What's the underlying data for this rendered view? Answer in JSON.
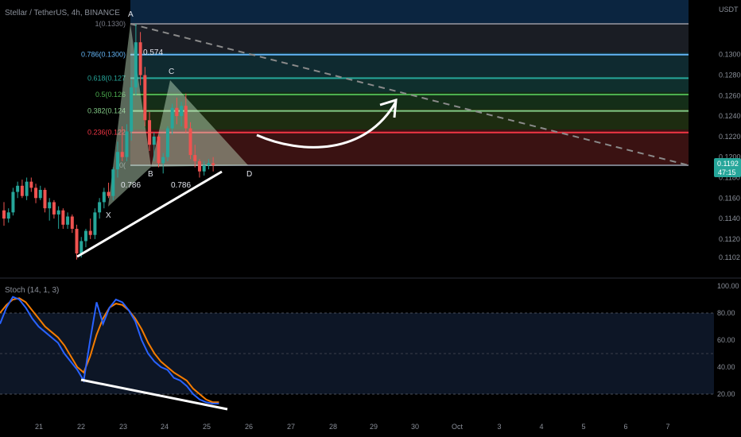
{
  "header": {
    "title": "Stellar / TetherUS, 4h, BINANCE",
    "currency": "USDT"
  },
  "indicator": {
    "label": "Stoch (14, 1, 3)"
  },
  "last_price": {
    "value": "0.1192",
    "countdown": "47:15",
    "color": "#26a69a"
  },
  "chart_data": [
    {
      "type": "candlestick",
      "x_dates": [
        "21",
        "22",
        "23",
        "24",
        "25",
        "26",
        "27",
        "28",
        "29",
        "30",
        "Oct",
        "3",
        "4",
        "5",
        "6",
        "7"
      ],
      "y_ticks": [
        "0.1300",
        "0.1280",
        "0.1260",
        "0.1240",
        "0.1220",
        "0.1200",
        "0.1180",
        "0.1160",
        "0.1140",
        "0.1120",
        "0.1102"
      ],
      "ylim": [
        0.1095,
        0.134
      ],
      "candles": [
        [
          0.1148,
          0.1156,
          0.1133,
          0.114
        ],
        [
          0.114,
          0.115,
          0.1136,
          0.1146
        ],
        [
          0.1146,
          0.117,
          0.1143,
          0.1166
        ],
        [
          0.1166,
          0.1176,
          0.116,
          0.1172
        ],
        [
          0.1172,
          0.1178,
          0.116,
          0.1162
        ],
        [
          0.1162,
          0.118,
          0.1158,
          0.1176
        ],
        [
          0.1176,
          0.118,
          0.1166,
          0.117
        ],
        [
          0.117,
          0.1174,
          0.1155,
          0.116
        ],
        [
          0.116,
          0.1172,
          0.1158,
          0.1168
        ],
        [
          0.1168,
          0.117,
          0.1146,
          0.115
        ],
        [
          0.115,
          0.116,
          0.1138,
          0.1156
        ],
        [
          0.1156,
          0.1158,
          0.114,
          0.1144
        ],
        [
          0.1144,
          0.1152,
          0.113,
          0.1148
        ],
        [
          0.1148,
          0.115,
          0.113,
          0.1134
        ],
        [
          0.1134,
          0.1146,
          0.113,
          0.1142
        ],
        [
          0.1142,
          0.1144,
          0.1126,
          0.113
        ],
        [
          0.113,
          0.1134,
          0.11,
          0.1106
        ],
        [
          0.1106,
          0.1122,
          0.1102,
          0.1118
        ],
        [
          0.1118,
          0.113,
          0.1112,
          0.1128
        ],
        [
          0.1128,
          0.114,
          0.112,
          0.1124
        ],
        [
          0.1124,
          0.115,
          0.112,
          0.1146
        ],
        [
          0.1146,
          0.116,
          0.114,
          0.1156
        ],
        [
          0.1156,
          0.117,
          0.115,
          0.1166
        ],
        [
          0.1166,
          0.1175,
          0.116,
          0.1162
        ],
        [
          0.1162,
          0.119,
          0.1158,
          0.1188
        ],
        [
          0.1188,
          0.1215,
          0.118,
          0.1205
        ],
        [
          0.1205,
          0.123,
          0.1196,
          0.12
        ],
        [
          0.12,
          0.1232,
          0.1196,
          0.1225
        ],
        [
          0.1225,
          0.1275,
          0.1216,
          0.1268
        ],
        [
          0.1268,
          0.133,
          0.126,
          0.1312
        ],
        [
          0.1312,
          0.1322,
          0.127,
          0.128
        ],
        [
          0.128,
          0.1288,
          0.123,
          0.1236
        ],
        [
          0.1236,
          0.1244,
          0.1206,
          0.1212
        ],
        [
          0.1212,
          0.1224,
          0.1196,
          0.122
        ],
        [
          0.122,
          0.1222,
          0.119,
          0.1194
        ],
        [
          0.1194,
          0.1204,
          0.1184,
          0.12
        ],
        [
          0.12,
          0.123,
          0.1196,
          0.1228
        ],
        [
          0.1228,
          0.1252,
          0.1222,
          0.1248
        ],
        [
          0.1248,
          0.1258,
          0.1232,
          0.124
        ],
        [
          0.124,
          0.1254,
          0.123,
          0.125
        ],
        [
          0.125,
          0.1262,
          0.1224,
          0.1228
        ],
        [
          0.1228,
          0.1234,
          0.1198,
          0.1202
        ],
        [
          0.1202,
          0.1212,
          0.119,
          0.1196
        ],
        [
          0.1196,
          0.1198,
          0.118,
          0.1186
        ],
        [
          0.1186,
          0.1196,
          0.1182,
          0.1192
        ],
        [
          0.1192,
          0.1198,
          0.1188,
          0.1194
        ],
        [
          0.1194,
          0.12,
          0.1186,
          0.1192
        ]
      ],
      "fib_levels": [
        {
          "label": "1(0.1330)",
          "value": 0.133,
          "color": "#787b86"
        },
        {
          "label": "0.786(0.1300)",
          "value": 0.13,
          "color": "#64b5f6"
        },
        {
          "label": "0.618(0.127",
          "value": 0.1277,
          "color": "#26a69a"
        },
        {
          "label": "0.5(0.126",
          "value": 0.1261,
          "color": "#4caf50"
        },
        {
          "label": "0.382(0.124",
          "value": 0.1245,
          "color": "#81c784"
        },
        {
          "label": "0.236(0.122",
          "value": 0.1224,
          "color": "#f23645"
        },
        {
          "label": "0(",
          "value": 0.1192,
          "color": "#787b86"
        }
      ],
      "pattern_points": {
        "X": "X",
        "A": "A",
        "B": "B",
        "C": "C",
        "D": "D"
      },
      "pattern_ratios": [
        "0.574",
        "0.786",
        "0.786"
      ]
    },
    {
      "type": "line",
      "title": "Stoch (14, 1, 3)",
      "y_ticks": [
        "100.00",
        "80.00",
        "60.00",
        "40.00",
        "20.00"
      ],
      "ylim": [
        0,
        100
      ],
      "bands": [
        20,
        50,
        80
      ],
      "series": [
        {
          "name": "%K",
          "color": "#2962ff",
          "values": [
            72,
            84,
            92,
            90,
            84,
            76,
            70,
            66,
            62,
            58,
            50,
            44,
            38,
            30,
            60,
            88,
            72,
            84,
            90,
            88,
            82,
            74,
            60,
            50,
            44,
            40,
            38,
            32,
            30,
            26,
            20,
            16,
            14,
            13,
            13
          ]
        },
        {
          "name": "%D",
          "color": "#f57c00",
          "values": [
            80,
            86,
            90,
            91,
            88,
            82,
            76,
            70,
            66,
            62,
            56,
            48,
            40,
            36,
            48,
            64,
            76,
            84,
            87,
            86,
            82,
            76,
            68,
            58,
            50,
            44,
            40,
            36,
            33,
            30,
            24,
            20,
            16,
            14,
            14
          ]
        }
      ]
    }
  ]
}
